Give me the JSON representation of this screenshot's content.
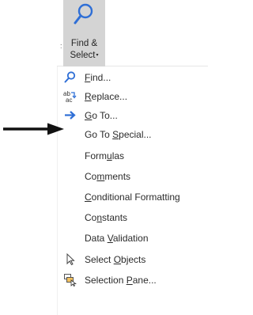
{
  "ribbon": {
    "group_edge_glyph": ":",
    "find_select": {
      "line1": "Find &",
      "line2": "Select",
      "caret": "▾",
      "icon": "magnifier-icon"
    }
  },
  "menu": {
    "items": [
      {
        "label": "Find...",
        "access_key": "F",
        "icon": "search-icon"
      },
      {
        "label": "Replace...",
        "access_key": "R",
        "icon": "replace-icon"
      },
      {
        "label": "Go To...",
        "access_key": "G",
        "icon": "arrow-right-icon"
      },
      {
        "label": "Go To Special...",
        "access_key": "S"
      },
      {
        "label": "Formulas",
        "access_key": "u"
      },
      {
        "label": "Comments",
        "access_key": "m"
      },
      {
        "label": "Conditional Formatting",
        "access_key": "C"
      },
      {
        "label": "Constants",
        "access_key": "n"
      },
      {
        "label": "Data Validation",
        "access_key": "V"
      },
      {
        "label": "Select Objects",
        "access_key": "O",
        "icon": "cursor-arrow-icon"
      },
      {
        "label": "Selection Pane...",
        "access_key": "P",
        "icon": "selection-pane-icon"
      }
    ]
  },
  "colors": {
    "button_pressed_bg": "#d4d4d4",
    "accent_blue": "#2f6fd6",
    "text": "#2b2b2b"
  }
}
